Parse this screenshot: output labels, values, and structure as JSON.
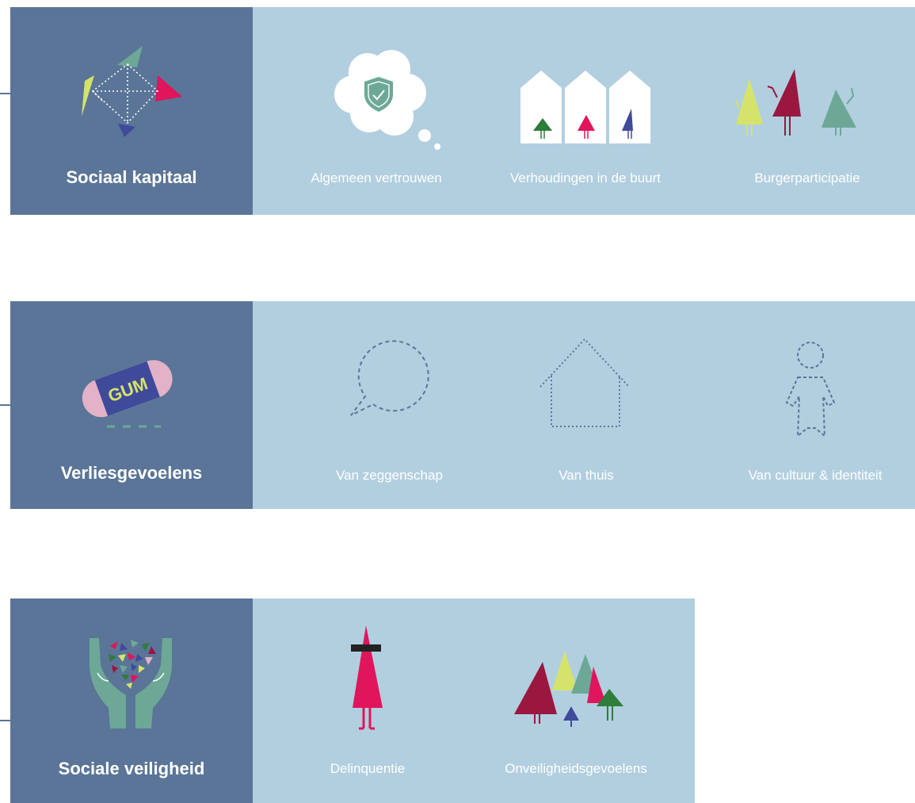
{
  "colors": {
    "header_bg": "#5a7597",
    "panel_bg": "#b2cfe0",
    "label_text": "#ffffff",
    "magenta": "#e0155b",
    "crimson": "#9a1740",
    "sage": "#6da897",
    "lime": "#d5e36b",
    "green": "#2e7d3a",
    "indigo": "#3f4a9b",
    "pink": "#e2b2c7"
  },
  "sections": [
    {
      "title": "Sociaal kapitaal",
      "icon": "crystal-icon",
      "items": [
        {
          "label": "Algemeen vertrouwen",
          "icon": "trust-cloud-icon"
        },
        {
          "label": "Verhoudingen in de buurt",
          "icon": "neighborhood-houses-icon"
        },
        {
          "label": "Burgerparticipatie",
          "icon": "citizens-icon"
        }
      ]
    },
    {
      "title": "Verliesgevoelens",
      "icon": "eraser-icon",
      "eraser_text": "GUM",
      "items": [
        {
          "label": "Van zeggenschap",
          "icon": "speech-bubble-icon"
        },
        {
          "label": "Van thuis",
          "icon": "house-outline-icon"
        },
        {
          "label": "Van cultuur & identiteit",
          "icon": "person-outline-icon"
        }
      ]
    },
    {
      "title": "Sociale veiligheid",
      "icon": "hands-icon",
      "items": [
        {
          "label": "Delinquentie",
          "icon": "masked-figure-icon"
        },
        {
          "label": "Onveiligheidsgevoelens",
          "icon": "crowd-icon"
        }
      ]
    }
  ]
}
